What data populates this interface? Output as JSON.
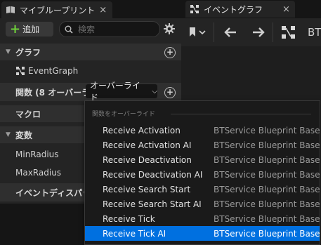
{
  "left_tab": {
    "label": "マイブループリント",
    "close": "×"
  },
  "toolbar": {
    "add_label": "追加",
    "search_placeholder": "検索"
  },
  "sections": {
    "graphs": {
      "title": "グラフ",
      "items": [
        "EventGraph"
      ]
    },
    "functions": {
      "title": "関数 (8 オーバーライ",
      "override_label": "オーバーライド"
    },
    "macros": {
      "title": "マクロ"
    },
    "variables": {
      "title": "変数",
      "items": [
        "MinRadius",
        "MaxRadius"
      ]
    },
    "dispatchers": {
      "title": "イベントディスパッチャ"
    }
  },
  "graph_tab": {
    "label": "イベントグラフ",
    "close": "×"
  },
  "graph_toolbar": {
    "bt_label": "BT"
  },
  "menu": {
    "header": "関数をオーバーライド",
    "items": [
      {
        "name": "Receive Activation",
        "source": "BTService Blueprint Base"
      },
      {
        "name": "Receive Activation AI",
        "source": "BTService Blueprint Base"
      },
      {
        "name": "Receive Deactivation",
        "source": "BTService Blueprint Base"
      },
      {
        "name": "Receive Deactivation AI",
        "source": "BTService Blueprint Base"
      },
      {
        "name": "Receive Search Start",
        "source": "BTService Blueprint Base"
      },
      {
        "name": "Receive Search Start AI",
        "source": "BTService Blueprint Base"
      },
      {
        "name": "Receive Tick",
        "source": "BTService Blueprint Base"
      },
      {
        "name": "Receive Tick AI",
        "source": "BTService Blueprint Base"
      }
    ],
    "selected_index": 7
  },
  "colors": {
    "accent_select": "#0070e0",
    "add_plus": "#6fcf3a"
  }
}
